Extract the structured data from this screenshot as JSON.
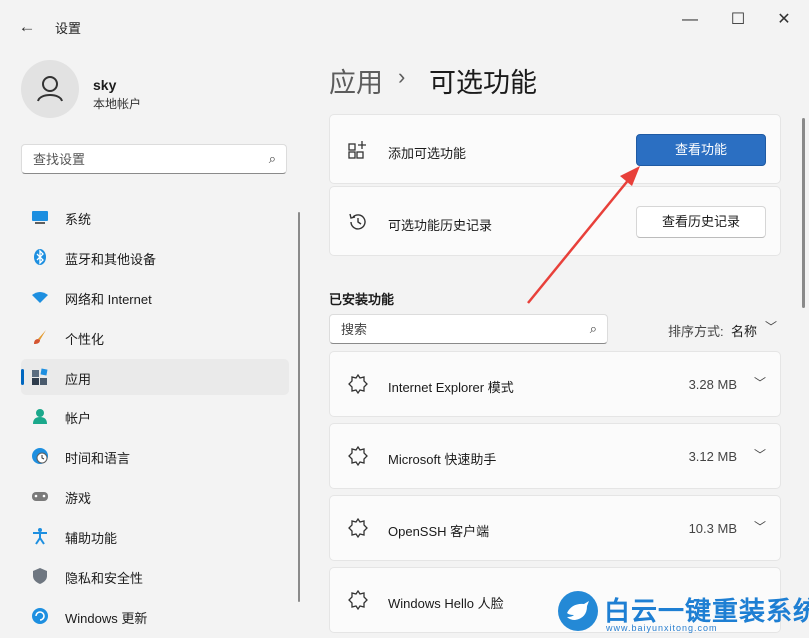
{
  "window": {
    "title": "设置",
    "back_glyph": "←",
    "minimize_glyph": "—",
    "maximize_glyph": "☐",
    "close_glyph": "✕"
  },
  "user": {
    "name": "sky",
    "account_type": "本地帐户"
  },
  "search": {
    "placeholder": "查找设置"
  },
  "sidebar": {
    "items": [
      {
        "label": "系统",
        "icon": "display-icon"
      },
      {
        "label": "蓝牙和其他设备",
        "icon": "bluetooth-icon"
      },
      {
        "label": "网络和 Internet",
        "icon": "wifi-icon"
      },
      {
        "label": "个性化",
        "icon": "brush-icon"
      },
      {
        "label": "应用",
        "icon": "apps-icon",
        "selected": true
      },
      {
        "label": "帐户",
        "icon": "person-icon"
      },
      {
        "label": "时间和语言",
        "icon": "globe-clock-icon"
      },
      {
        "label": "游戏",
        "icon": "gamepad-icon"
      },
      {
        "label": "辅助功能",
        "icon": "accessibility-icon"
      },
      {
        "label": "隐私和安全性",
        "icon": "shield-icon"
      },
      {
        "label": "Windows 更新",
        "icon": "update-icon"
      }
    ]
  },
  "breadcrumb": {
    "parent": "应用",
    "separator": "›",
    "current": "可选功能"
  },
  "add_feature": {
    "label": "添加可选功能",
    "button": "查看功能"
  },
  "history": {
    "label": "可选功能历史记录",
    "button": "查看历史记录"
  },
  "installed": {
    "title": "已安装功能",
    "search_placeholder": "搜索",
    "sort_label": "排序方式:",
    "sort_value": "名称",
    "features": [
      {
        "name": "Internet Explorer 模式",
        "size": "3.28 MB"
      },
      {
        "name": "Microsoft 快速助手",
        "size": "3.12 MB"
      },
      {
        "name": "OpenSSH 客户端",
        "size": "10.3 MB"
      },
      {
        "name": "Windows Hello 人脸",
        "size": ""
      }
    ]
  },
  "watermark": {
    "title": "白云一键重装系统",
    "url": "www.baiyunxitong.com"
  },
  "colors": {
    "accent": "#0067c0",
    "primary_button": "#2b6fc2",
    "arrow": "#e8403a"
  }
}
